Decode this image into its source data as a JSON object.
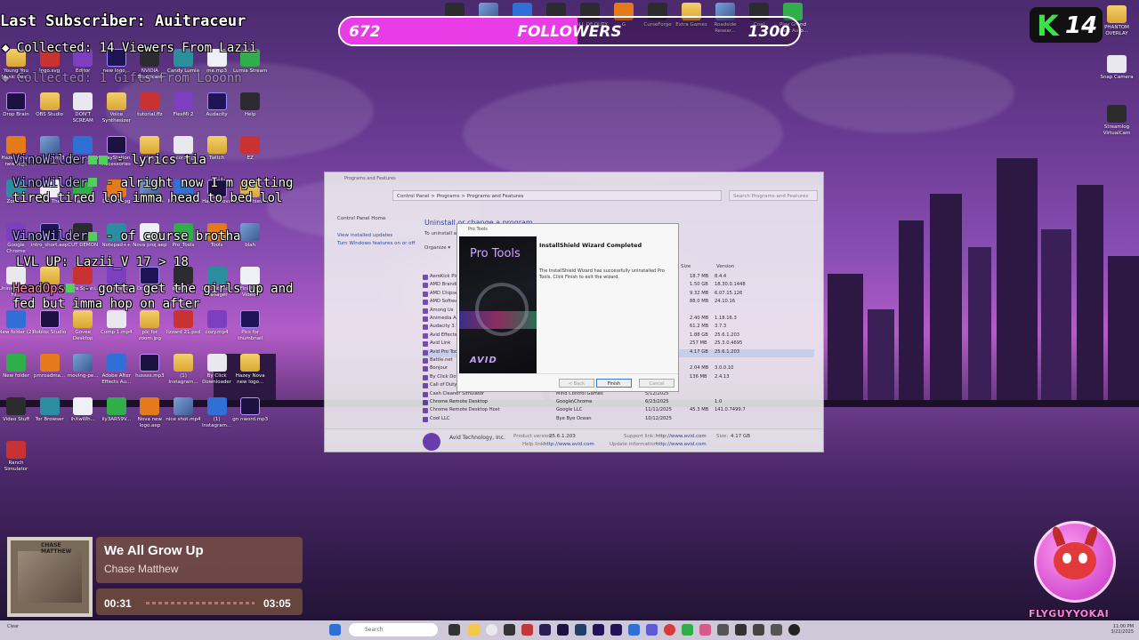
{
  "chat": {
    "last_subscriber": "Last Subscriber: Auitraceur",
    "collected_viewers": "◆ Collected: 14 Viewers From Lazii",
    "collected_gifts": "◆ Collected: 1 Gifts From Looonn",
    "messages": [
      {
        "user": "VinoWilder",
        "text": "- lyrics tia"
      },
      {
        "user": "VinoWilder",
        "text": "- alright now I'm getting tired tired lol imma head to bed lol"
      },
      {
        "user": "VinoWilder",
        "text": "- of course brotha"
      },
      {
        "user": "",
        "text": "LVL UP: Lazii_V 17 > 18"
      },
      {
        "user": "HeadOps",
        "text": "- gotta get the girls up and fed but imma hop on after"
      }
    ]
  },
  "followers": {
    "current": "672",
    "label": "FOLLOWERS",
    "goal": "1300",
    "progress": 0.517
  },
  "badge": {
    "letter": "K",
    "number": "14"
  },
  "explorer": {
    "title": "Programs and Features",
    "breadcrumb": "Control Panel  >  Programs  >  Programs and Features",
    "search_placeholder": "Search Programs and Features",
    "side_home": "Control Panel Home",
    "side_links": [
      "View installed updates",
      "Turn Windows features on or off"
    ],
    "heading": "Uninstall or change a program",
    "subheading": "To uninstall a program, select it from the list and then click Uninstall, Change, or Repair.",
    "organize": "Organize ▾",
    "col_size": "Size",
    "col_version": "Version",
    "rows": [
      {
        "name": "AeroKick Plus",
        "publisher": "",
        "date": "",
        "size": "18.7 MB",
        "version": "8.4.4"
      },
      {
        "name": "AMD Branding",
        "publisher": "",
        "date": "",
        "size": "1.50 GB",
        "version": "18.30.0.1448"
      },
      {
        "name": "AMD Chipset Software",
        "publisher": "",
        "date": "",
        "size": "9.32 MB",
        "version": "6.07.15.126"
      },
      {
        "name": "AMD Software",
        "publisher": "",
        "date": "",
        "size": "88.0 MB",
        "version": "24.10.16"
      },
      {
        "name": "Among Us",
        "publisher": "",
        "date": "",
        "size": "",
        "version": ""
      },
      {
        "name": "Animedia ASM",
        "publisher": "",
        "date": "",
        "size": "2.40 MB",
        "version": "1.18.16.3"
      },
      {
        "name": "Audacity 3.7.3",
        "publisher": "",
        "date": "",
        "size": "61.2 MB",
        "version": "3.7.3"
      },
      {
        "name": "Avid Effects",
        "publisher": "",
        "date": "",
        "size": "1.88 GB",
        "version": "25.6.1.203"
      },
      {
        "name": "Avid Link",
        "publisher": "",
        "date": "",
        "size": "257 MB",
        "version": "25.3.0.4695"
      },
      {
        "name": "Avid Pro Tools",
        "publisher": "",
        "date": "",
        "size": "4.17 GB",
        "version": "25.6.1.203"
      },
      {
        "name": "Battle.net",
        "publisher": "",
        "date": "",
        "size": "",
        "version": ""
      },
      {
        "name": "Bonjour",
        "publisher": "",
        "date": "",
        "size": "2.04 MB",
        "version": "3.0.0.10"
      },
      {
        "name": "By Click Downloader",
        "publisher": "",
        "date": "",
        "size": "136 MB",
        "version": "2.4.13"
      },
      {
        "name": "Call of Duty®",
        "publisher": "",
        "date": "",
        "size": "",
        "version": ""
      },
      {
        "name": "Cash Cleaner Simulator",
        "publisher": "Mind Control Games",
        "date": "5/12/2025",
        "size": "",
        "version": ""
      },
      {
        "name": "Chrome Remote Desktop",
        "publisher": "Google\\Chrome",
        "date": "6/23/2025",
        "size": "",
        "version": "1.0"
      },
      {
        "name": "Chrome Remote Desktop Host",
        "publisher": "Google LLC",
        "date": "11/11/2025",
        "size": "45.3 MB",
        "version": "141.0.7499.7"
      },
      {
        "name": "Cool LLC",
        "publisher": "Bye Bye Ocean",
        "date": "10/12/2025",
        "size": "",
        "version": ""
      }
    ],
    "status": {
      "publisher": "Avid Technology, Inc.",
      "product_version_label": "Product version:",
      "product_version": "25.6.1.203",
      "help_link_label": "Help link:",
      "help_link": "http://www.avid.com",
      "support_label": "Support link:",
      "support_link": "http://www.avid.com",
      "update_label": "Update information:",
      "update_link": "http://www.avid.com",
      "size_label": "Size:",
      "size": "4.17 GB"
    }
  },
  "wizard": {
    "title": "Pro Tools",
    "brand": "Pro Tools",
    "vendor_logo": "AVID",
    "heading": "InstallShield Wizard Completed",
    "body": "The InstallShield Wizard has successfully uninstalled Pro Tools. Click Finish to exit the wizard.",
    "back": "< Back",
    "finish": "Finish",
    "cancel": "Cancel"
  },
  "now_playing": {
    "title": "We All Grow Up",
    "artist": "Chase Matthew",
    "art_label": "CHASE MATTHEW",
    "elapsed": "00:31",
    "duration": "03:05"
  },
  "mascot": {
    "name": "FLYGUYYOKAI"
  },
  "desktop_icons": [
    "Young You Music Des...",
    "logo.svg",
    "Editor",
    "new logo...",
    "NVIDIA Broadcast",
    "Candy Lumia",
    "me.mp3",
    "Lumia Stream",
    "Drop Brain",
    "OBS Studio",
    "DON'T SCREAM",
    "Voice Synthesizer",
    "tutorial.ffz",
    "FlexMi 2",
    "Audacity",
    "Help",
    "Hazey Nova new logo",
    "OUTRO.mp3",
    "Lumia Stream",
    "PlayStation Accessories",
    "Hub",
    "Recordings",
    "Twitch",
    "EZ",
    "Zombie",
    "Grand Theft",
    "Gaming",
    "DELETE.jpg",
    "Notepad++",
    "MC Mods.zip",
    "Hazey Nova",
    "Sea of Thieves",
    "Google Chrome",
    "intro_short.aep",
    "CUT DEMON",
    "Notepad++",
    "Nova proj.aep",
    "Pro_Tools",
    "Tools",
    "blah",
    "Uninstall Only Fil...",
    "Logo Options",
    "Nova Spinni...",
    "kick-strea...",
    "Dread-1f...",
    "bk8_9b...",
    "LUK License Manager",
    "Finished Videos",
    "New folder (2)",
    "Roblox Studio",
    "Govee Desktop",
    "Comp 1.mp4",
    "pic for zoom.jpg",
    "lizzard 21.psd",
    "cozy.mp4",
    "Pics for thumbnail",
    "New folder",
    "pmroadma...",
    "moving-pe...",
    "Adobe After Effects Au...",
    "hussss.mp3",
    "(1) Instagram...",
    "By Click Downloader",
    "Hazey Nova new logo...",
    "Video Stuff",
    "Tor Browser",
    "ihXwWh...",
    "lly3AR59V...",
    "Nova new logo.aep",
    "nice shot.mp4",
    "(1) Instagram...",
    "gn nword.mp3",
    "Ranch Simulator"
  ],
  "right_icons": [
    "PHANTOM OVERLAY",
    "Snap Camera",
    "Streamlog VirtualCam"
  ],
  "top_icons": [
    "RAGE",
    "AIO",
    "Steam",
    "Voicemod",
    "CALL OF DUTY",
    "G",
    "CurseForge",
    "Extra Games",
    "Roadside Resear...",
    "Coal",
    "Play Grand Theft Auto..."
  ],
  "taskbar": {
    "search_placeholder": "Search",
    "left_status": "Clear",
    "time": "11:00 PM",
    "date": "3/22/2025"
  }
}
